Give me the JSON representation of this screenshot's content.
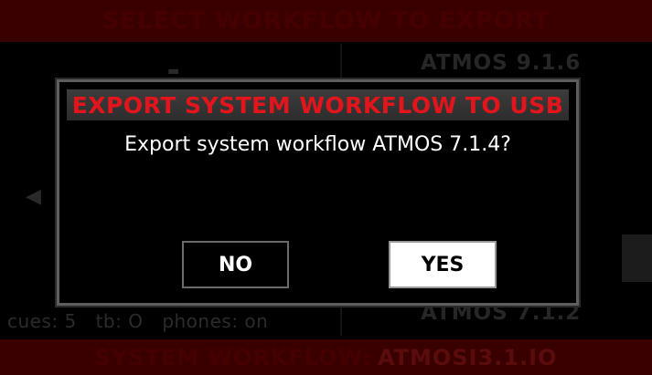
{
  "header": {
    "title": "SELECT WORKFLOW TO EXPORT"
  },
  "workflow_list": {
    "items": [
      "ATMOS 9.1.6",
      "ATMOS 7.1.2"
    ]
  },
  "status_bar": {
    "cues": "cues: 5",
    "tb": "tb: O",
    "phones": "phones: on"
  },
  "footer": {
    "label": "SYSTEM WORKFLOW:",
    "value": "ATMOSI3.1.IO"
  },
  "dialog": {
    "title": "EXPORT SYSTEM WORKFLOW TO USB",
    "message": "Export system workflow ATMOS 7.1.4?",
    "no_label": "NO",
    "yes_label": "YES"
  },
  "colors": {
    "title_red": "#e3151c",
    "header_bg": "#3a0000",
    "dialog_border": "#5e5e5e"
  },
  "icons": {
    "speaker": "speaker-icon"
  }
}
